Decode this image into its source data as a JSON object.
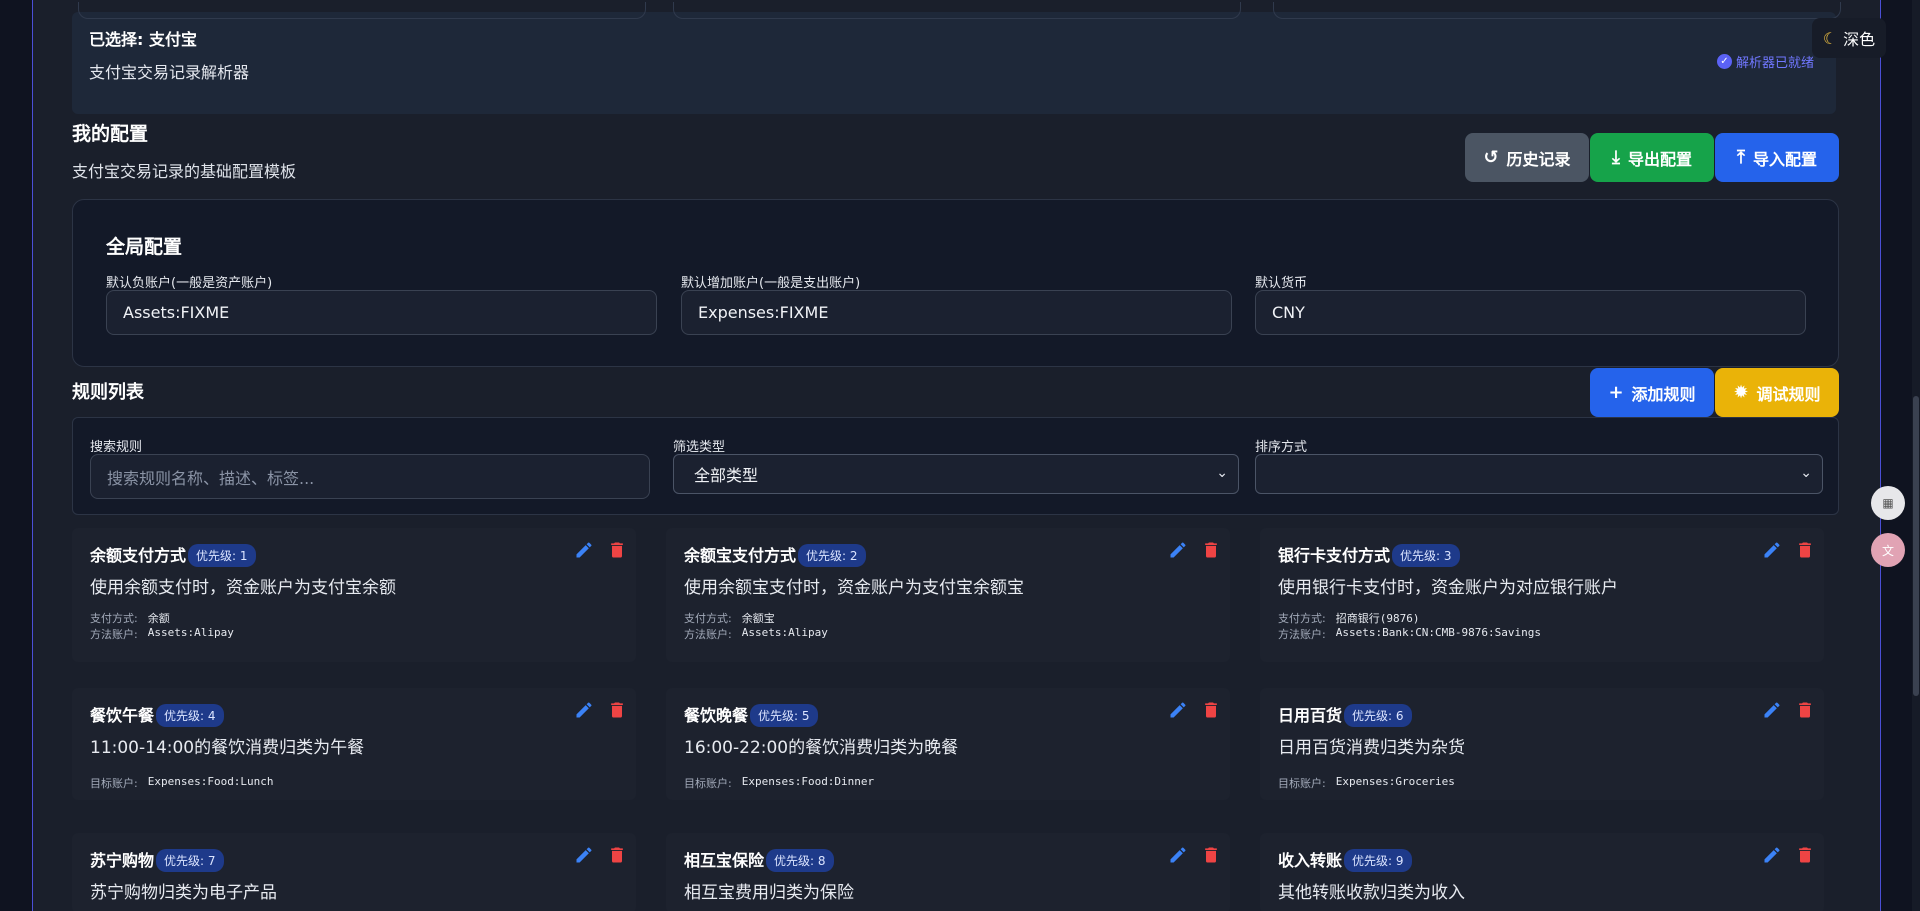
{
  "header": {
    "parser_selected": "已选择: 支付宝",
    "parser_desc": "支付宝交易记录解析器",
    "parser_status": "解析器已就绪",
    "theme_label": "深色"
  },
  "config": {
    "title": "我的配置",
    "subtitle": "支付宝交易记录的基础配置模板",
    "buttons": {
      "history": "历史记录",
      "export": "导出配置",
      "import": "导入配置"
    }
  },
  "global": {
    "title": "全局配置",
    "fields": [
      {
        "label": "默认负账户(一般是资产账户)",
        "value": "Assets:FIXME"
      },
      {
        "label": "默认增加账户(一般是支出账户)",
        "value": "Expenses:FIXME"
      },
      {
        "label": "默认货币",
        "value": "CNY"
      }
    ]
  },
  "rules": {
    "title": "规则列表",
    "add_label": "添加规则",
    "debug_label": "调试规则",
    "search_label": "搜索规则",
    "search_placeholder": "搜索规则名称、描述、标签...",
    "type_label": "筛选类型",
    "type_value": "全部类型",
    "sort_label": "排序方式",
    "sort_value": "",
    "items": [
      {
        "name": "余额支付方式",
        "priority": "优先级: 1",
        "desc": "使用余额支付时，资金账户为支付宝余额",
        "meta": [
          {
            "k": "支付方式:",
            "v": "余额"
          },
          {
            "k": "方法账户:",
            "v": "Assets:Alipay"
          }
        ]
      },
      {
        "name": "余额宝支付方式",
        "priority": "优先级: 2",
        "desc": "使用余额宝支付时，资金账户为支付宝余额宝",
        "meta": [
          {
            "k": "支付方式:",
            "v": "余额宝"
          },
          {
            "k": "方法账户:",
            "v": "Assets:Alipay"
          }
        ]
      },
      {
        "name": "银行卡支付方式",
        "priority": "优先级: 3",
        "desc": "使用银行卡支付时，资金账户为对应银行账户",
        "meta": [
          {
            "k": "支付方式:",
            "v": "招商银行(9876)"
          },
          {
            "k": "方法账户:",
            "v": "Assets:Bank:CN:CMB-9876:Savings"
          }
        ]
      },
      {
        "name": "餐饮午餐",
        "priority": "优先级: 4",
        "desc": "11:00-14:00的餐饮消费归类为午餐",
        "meta": [
          {
            "k": "目标账户:",
            "v": "Expenses:Food:Lunch"
          }
        ]
      },
      {
        "name": "餐饮晚餐",
        "priority": "优先级: 5",
        "desc": "16:00-22:00的餐饮消费归类为晚餐",
        "meta": [
          {
            "k": "目标账户:",
            "v": "Expenses:Food:Dinner"
          }
        ]
      },
      {
        "name": "日用百货",
        "priority": "优先级: 6",
        "desc": "日用百货消费归类为杂货",
        "meta": [
          {
            "k": "目标账户:",
            "v": "Expenses:Groceries"
          }
        ]
      },
      {
        "name": "苏宁购物",
        "priority": "优先级: 7",
        "desc": "苏宁购物归类为电子产品",
        "meta": []
      },
      {
        "name": "相互宝保险",
        "priority": "优先级: 8",
        "desc": "相互宝费用归类为保险",
        "meta": []
      },
      {
        "name": "收入转账",
        "priority": "优先级: 9",
        "desc": "其他转账收款归类为收入",
        "meta": []
      }
    ]
  }
}
